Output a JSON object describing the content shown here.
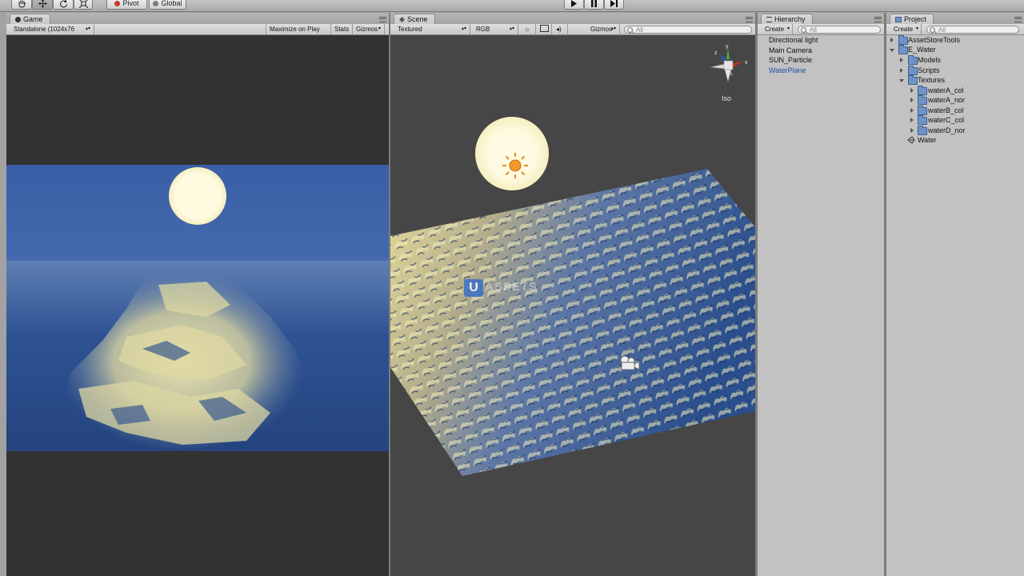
{
  "toolbar": {
    "tools": [
      {
        "name": "hand-tool",
        "icon": "hand-icon"
      },
      {
        "name": "move-tool",
        "icon": "move-arrows-icon"
      },
      {
        "name": "rotate-tool",
        "icon": "rotate-icon"
      },
      {
        "name": "scale-tool",
        "icon": "scale-icon"
      }
    ],
    "pivot_label": "Pivot",
    "global_label": "Global",
    "playback": [
      "play-icon",
      "pause-icon",
      "step-icon"
    ]
  },
  "game_panel": {
    "tab_label": "Game",
    "aspect_dropdown": "Standalone (1024x76",
    "maximize_label": "Maximize on Play",
    "stats_label": "Stats",
    "gizmos_label": "Gizmos"
  },
  "scene_panel": {
    "tab_label": "Scene",
    "render_mode": "Textured",
    "color_mode": "RGB",
    "gizmos_label": "Gizmos",
    "search_placeholder": "All",
    "projection_label": "Iso",
    "gizmo_axes": {
      "y": "y",
      "x": "x",
      "z": "z"
    },
    "watermark": "ASSETS",
    "watermark_badge": "U"
  },
  "hierarchy_panel": {
    "tab_label": "Hierarchy",
    "create_label": "Create",
    "search_placeholder": "All",
    "items": [
      {
        "label": "Directional light",
        "selected": false
      },
      {
        "label": "Main Camera",
        "selected": false
      },
      {
        "label": "SUN_Particle",
        "selected": false
      },
      {
        "label": "WaterPlane",
        "selected": true
      }
    ]
  },
  "project_panel": {
    "tab_label": "Project",
    "create_label": "Create",
    "search_placeholder": "All",
    "items": [
      {
        "label": "AssetStoreTools",
        "type": "folder",
        "depth": 0,
        "expanded": false
      },
      {
        "label": "E_Water",
        "type": "folder",
        "depth": 0,
        "expanded": true
      },
      {
        "label": "Models",
        "type": "folder",
        "depth": 1,
        "expanded": false
      },
      {
        "label": "Scripts",
        "type": "folder",
        "depth": 1,
        "expanded": false
      },
      {
        "label": "Textures",
        "type": "folder",
        "depth": 1,
        "expanded": true
      },
      {
        "label": "waterA_col",
        "type": "folder",
        "depth": 2,
        "expanded": false
      },
      {
        "label": "waterA_nor",
        "type": "folder",
        "depth": 2,
        "expanded": false
      },
      {
        "label": "waterB_col",
        "type": "folder",
        "depth": 2,
        "expanded": false
      },
      {
        "label": "waterC_col",
        "type": "folder",
        "depth": 2,
        "expanded": false
      },
      {
        "label": "waterD_nor",
        "type": "folder",
        "depth": 2,
        "expanded": false
      },
      {
        "label": "Water",
        "type": "shader",
        "depth": 1,
        "expanded": false
      }
    ]
  },
  "colors": {
    "editor_bg": "#c2c2c2",
    "selection_text": "#1e4fa8",
    "water_blue": "#3a5fa6",
    "sun": "#fdf6c8"
  }
}
